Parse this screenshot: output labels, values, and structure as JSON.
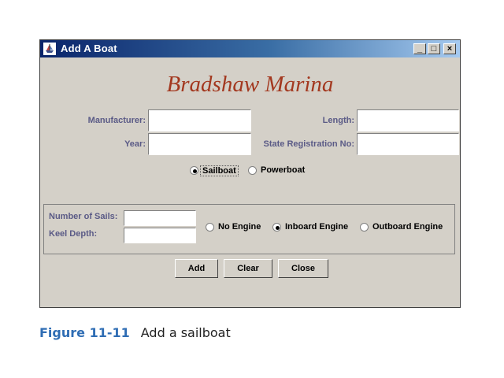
{
  "window": {
    "title": "Add A Boat",
    "minimize": "_",
    "maximize": "□",
    "close": "×"
  },
  "brand": "Bradshaw Marina",
  "form": {
    "manufacturer_label": "Manufacturer:",
    "manufacturer_value": "",
    "year_label": "Year:",
    "year_value": "",
    "length_label": "Length:",
    "length_value": "",
    "state_reg_label": "State Registration No:",
    "state_reg_value": ""
  },
  "boat_type": {
    "options": [
      {
        "label": "Sailboat",
        "selected": true
      },
      {
        "label": "Powerboat",
        "selected": false
      }
    ]
  },
  "sailboat_panel": {
    "num_sails_label": "Number of Sails:",
    "num_sails_value": "",
    "keel_depth_label": "Keel Depth:",
    "keel_depth_value": "",
    "engine_options": [
      {
        "label": "No Engine",
        "selected": false
      },
      {
        "label": "Inboard Engine",
        "selected": true
      },
      {
        "label": "Outboard Engine",
        "selected": false
      }
    ]
  },
  "buttons": {
    "add": "Add",
    "clear": "Clear",
    "close": "Close"
  },
  "caption": {
    "number": "Figure 11-11",
    "text": "Add a sailboat"
  },
  "colors": {
    "brand": "#a3381f",
    "label": "#5a5a86",
    "caption_number": "#2f6db4",
    "titlebar_start": "#0a246a"
  }
}
